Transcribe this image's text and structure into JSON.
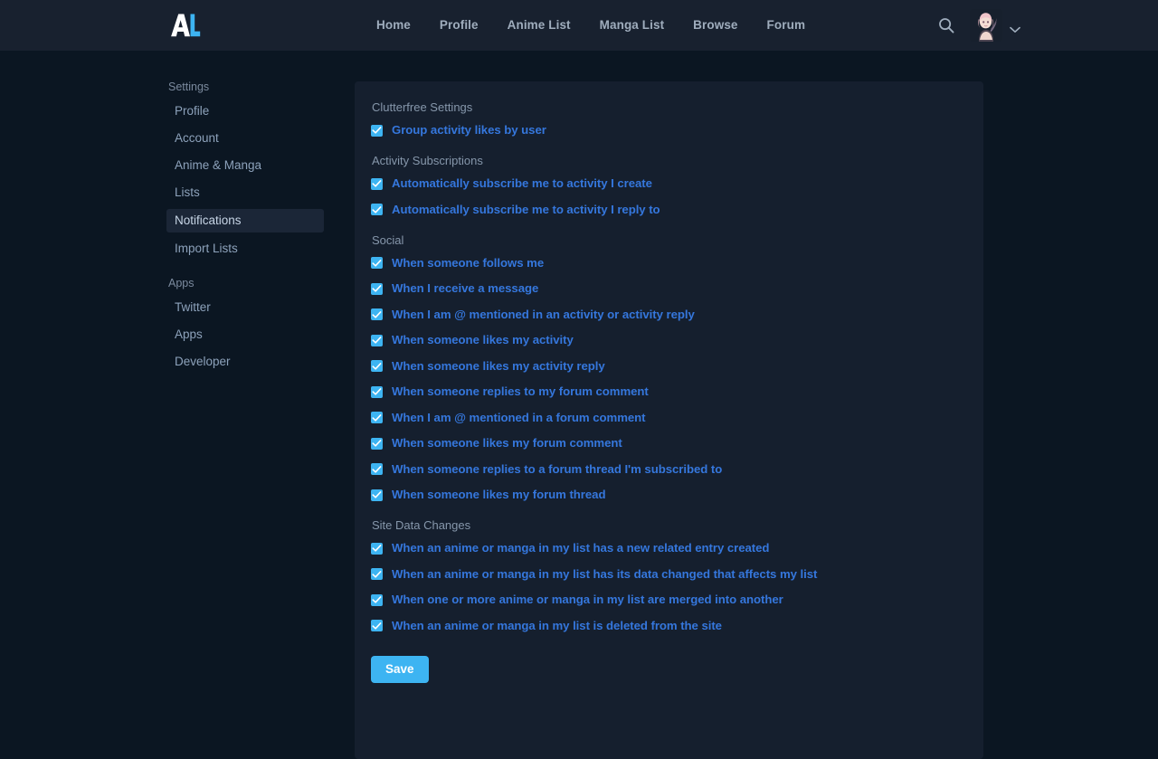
{
  "header": {
    "logo_name": "anilist-logo",
    "nav": [
      {
        "label": "Home"
      },
      {
        "label": "Profile"
      },
      {
        "label": "Anime List"
      },
      {
        "label": "Manga List"
      },
      {
        "label": "Browse"
      },
      {
        "label": "Forum"
      }
    ],
    "search_icon": "search-icon",
    "avatar_icon": "user-avatar",
    "chevron_icon": "chevron-down-icon"
  },
  "sidebar": {
    "groups": [
      {
        "title": "Settings",
        "items": [
          {
            "label": "Profile",
            "active": false
          },
          {
            "label": "Account",
            "active": false
          },
          {
            "label": "Anime & Manga",
            "active": false
          },
          {
            "label": "Lists",
            "active": false
          },
          {
            "label": "Notifications",
            "active": true
          },
          {
            "label": "Import Lists",
            "active": false
          }
        ]
      },
      {
        "title": "Apps",
        "items": [
          {
            "label": "Twitter",
            "active": false
          },
          {
            "label": "Apps",
            "active": false
          },
          {
            "label": "Developer",
            "active": false
          }
        ]
      }
    ]
  },
  "main": {
    "sections": [
      {
        "title": "Clutterfree Settings",
        "options": [
          {
            "label": "Group activity likes by user",
            "checked": true
          }
        ]
      },
      {
        "title": "Activity Subscriptions",
        "options": [
          {
            "label": "Automatically subscribe me to activity I create",
            "checked": true
          },
          {
            "label": "Automatically subscribe me to activity I reply to",
            "checked": true
          }
        ]
      },
      {
        "title": "Social",
        "options": [
          {
            "label": "When someone follows me",
            "checked": true
          },
          {
            "label": "When I receive a message",
            "checked": true
          },
          {
            "label": "When I am @ mentioned in an activity or activity reply",
            "checked": true
          },
          {
            "label": "When someone likes my activity",
            "checked": true
          },
          {
            "label": "When someone likes my activity reply",
            "checked": true
          },
          {
            "label": "When someone replies to my forum comment",
            "checked": true
          },
          {
            "label": "When I am @ mentioned in a forum comment",
            "checked": true
          },
          {
            "label": "When someone likes my forum comment",
            "checked": true
          },
          {
            "label": "When someone replies to a forum thread I'm subscribed to",
            "checked": true
          },
          {
            "label": "When someone likes my forum thread",
            "checked": true
          }
        ]
      },
      {
        "title": "Site Data Changes",
        "options": [
          {
            "label": "When an anime or manga in my list has a new related entry created",
            "checked": true
          },
          {
            "label": "When an anime or manga in my list has its data changed that affects my list",
            "checked": true
          },
          {
            "label": "When one or more anime or manga in my list are merged into another",
            "checked": true
          },
          {
            "label": "When an anime or manga in my list is deleted from the site",
            "checked": true
          }
        ]
      }
    ],
    "save_label": "Save"
  },
  "colors": {
    "page_bg": "#0b1622",
    "header_bg": "#18212f",
    "card_bg": "#151f2e",
    "accent": "#3db4f2",
    "label_blue": "#3577dd",
    "muted": "#8697ab",
    "sidebar_active_bg": "#1b2637"
  }
}
